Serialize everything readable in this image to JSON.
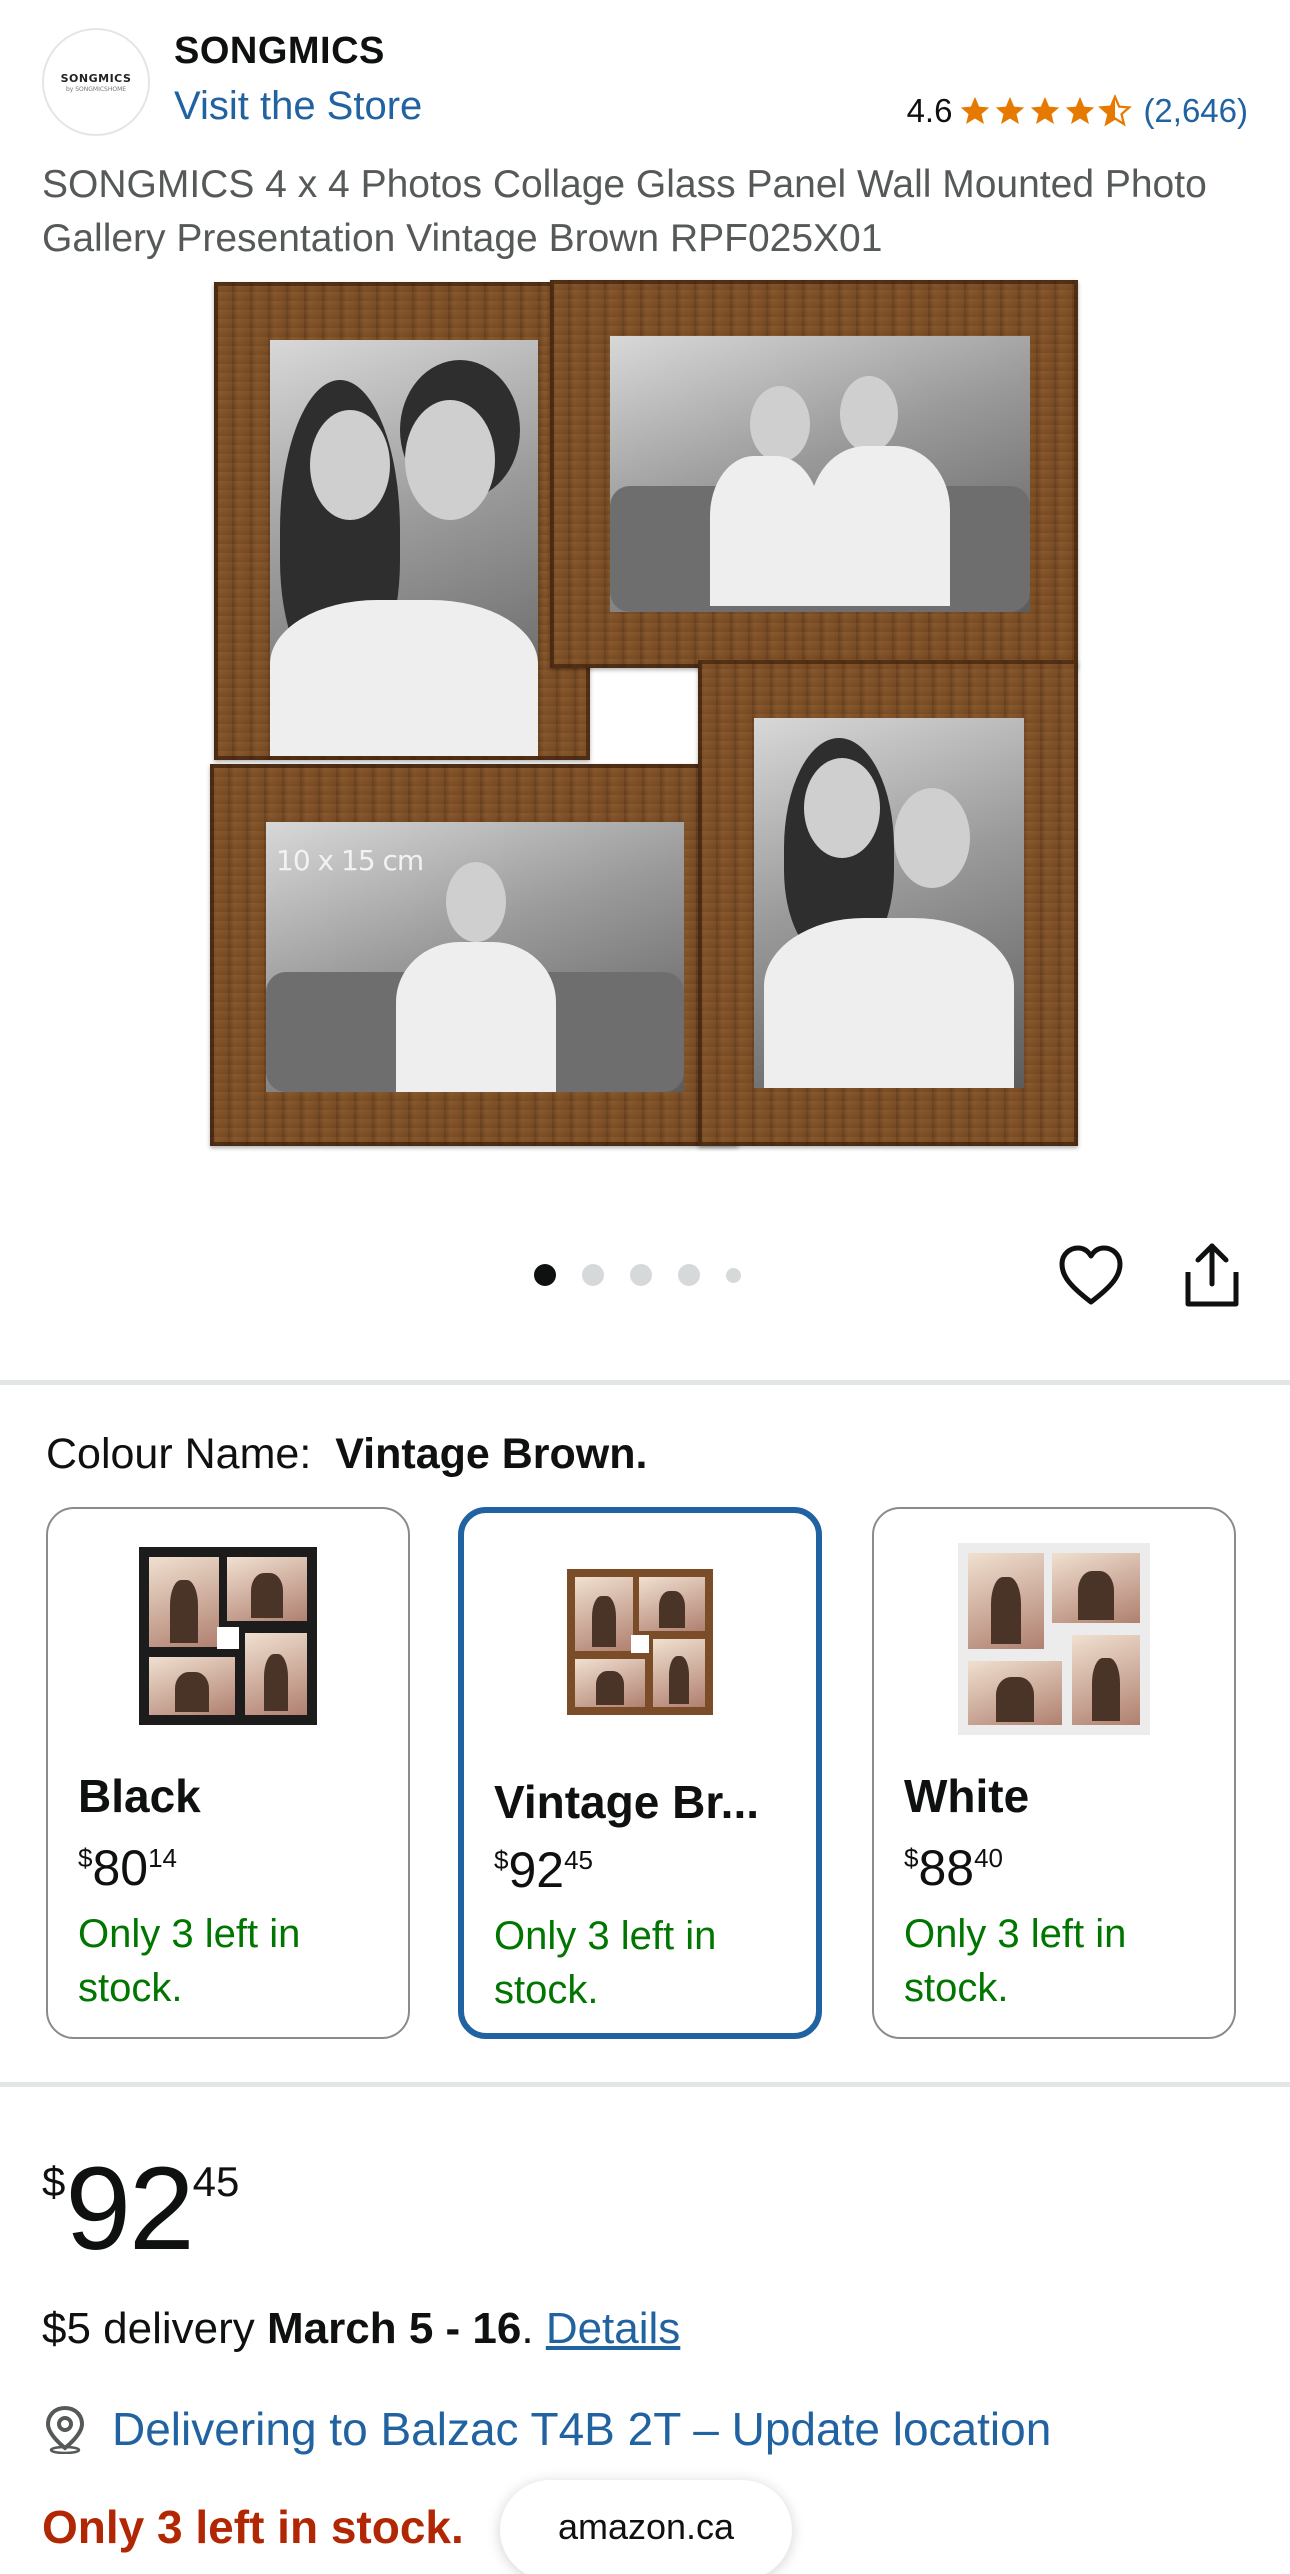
{
  "store": {
    "logo_text": "SONGMICS",
    "logo_subtext": "by SONGMICSHOME",
    "brand": "SONGMICS",
    "visit_label": "Visit the Store"
  },
  "rating": {
    "value": "4.6",
    "stars": 4.5,
    "count": "(2,646)",
    "star_color": "#e67a00"
  },
  "product": {
    "title": "SONGMICS 4 x 4 Photos Collage Glass Panel Wall Mounted Photo Gallery Presentation Vintage Brown RPF025X01",
    "image_size_label": "10 x 15 cm"
  },
  "carousel": {
    "total_dots": 5,
    "active_index": 0
  },
  "colour": {
    "label": "Colour Name:",
    "selected": "Vintage Brown.",
    "options": [
      {
        "name": "Black",
        "price_currency": "$",
        "price_whole": "80",
        "price_fraction": "14",
        "stock": "Only 3 left in stock."
      },
      {
        "name": "Vintage Br...",
        "price_currency": "$",
        "price_whole": "92",
        "price_fraction": "45",
        "stock": "Only 3 left in stock."
      },
      {
        "name": "White",
        "price_currency": "$",
        "price_whole": "88",
        "price_fraction": "40",
        "stock": "Only 3 left in stock."
      }
    ]
  },
  "price": {
    "currency": "$",
    "whole": "92",
    "fraction": "45"
  },
  "delivery": {
    "prefix": "$5 delivery ",
    "dates": "March 5 - 16",
    "suffix": ". ",
    "details_link": "Details"
  },
  "location": {
    "text": "Delivering to Balzac T4B 2T – Update location"
  },
  "stock": {
    "text": "Only 3 left in stock."
  },
  "browser": {
    "domain": "amazon.ca"
  },
  "colors": {
    "link": "#2162a1",
    "in_stock": "#007600",
    "low_stock": "#b12704",
    "selected_border": "#2162a1"
  }
}
